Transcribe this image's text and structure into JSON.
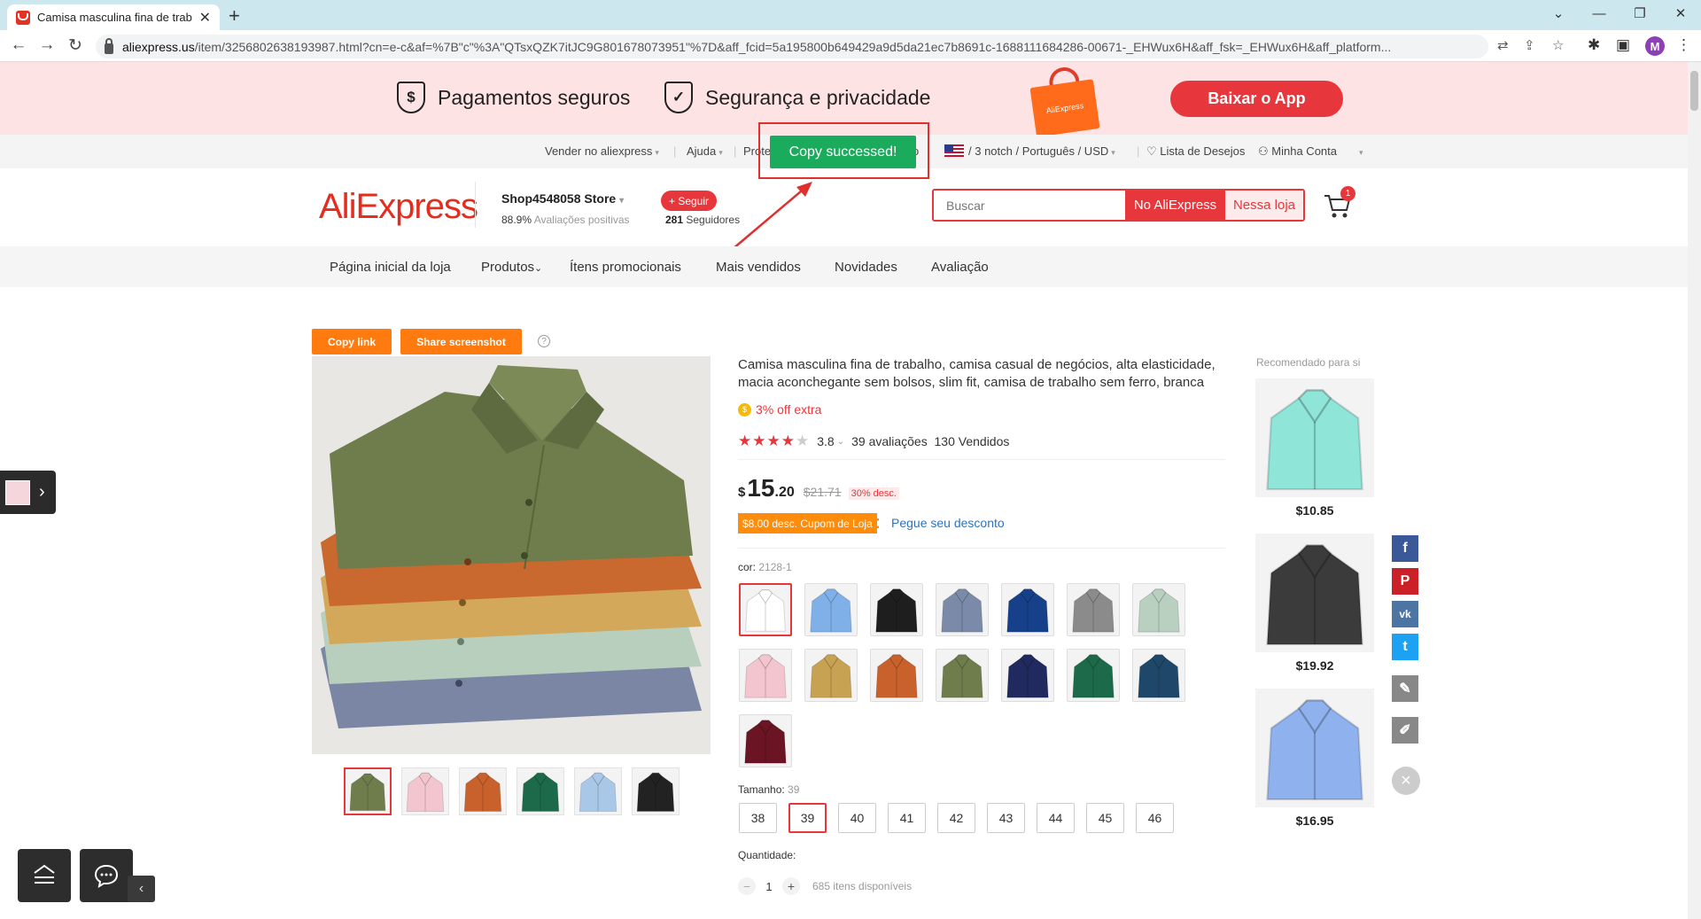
{
  "browser": {
    "tab_title": "Camisa masculina fina de trab",
    "url_host": "aliexpress.us",
    "url_rest": "/item/3256802638193987.html?cn=e-c&af=%7B\"c\"%3A\"QTsxQZK7itJC9G801678073951\"%7D&aff_fcid=5a195800b649429a9d5da21ec7b8691c-1688111684286-00671-_EHWux6H&aff_fsk=_EHWux6H&aff_platform...",
    "profile_initial": "M",
    "minimize": "⌄",
    "accent": "#cde7ee"
  },
  "promo": {
    "secure_payments": "Pagamentos seguros",
    "security_privacy": "Segurança e privacidade",
    "bag_text": "AliExpress",
    "app_button": "Baixar o App"
  },
  "topnav": {
    "sell": "Vender no aliexpress",
    "help": "Ajuda",
    "protection": "Prote",
    "protection_tail": "o",
    "region": "/ 3 notch / Português / USD",
    "wishlist": "Lista de Desejos",
    "account": "Minha Conta"
  },
  "toast": {
    "text": "Copy successed!",
    "color": "#1aab5d"
  },
  "store": {
    "logo": "AliExpress",
    "name": "Shop4548058 Store",
    "rating_pct": "88.9%",
    "rating_label": "Avaliações positivas",
    "follow": "+ Seguir",
    "followers_count": "281",
    "followers_label": "Seguidores",
    "search_placeholder": "Buscar",
    "search_ali": "No AliExpress",
    "search_store": "Nessa loja",
    "cart_count": "1"
  },
  "storenav": [
    "Página inicial da loja",
    "Produtos",
    "Ítens promocionais",
    "Mais vendidos",
    "Novidades",
    "Avaliação"
  ],
  "actions": {
    "copy_link": "Copy link",
    "share_screenshot": "Share screenshot",
    "help": "?"
  },
  "product": {
    "title": "Camisa masculina fina de trabalho, camisa casual de negócios, alta elasticidade, macia aconchegante sem bolsos, slim fit, camisa de trabalho sem ferro, branca",
    "extra": "3% off extra",
    "rating": "3.8",
    "rating_stars": 3.8,
    "reviews": "39 avaliações",
    "sold": "130 Vendidos",
    "currency": "$",
    "price_int": "15",
    "price_dec": ".20",
    "price_old": "$21.71",
    "discount": "30% desc.",
    "coupon": "$8.00 desc. Cupom de Loja",
    "coupon_link": "Pegue seu desconto",
    "color_label": "cor:",
    "color_value": "2128-1",
    "colors": [
      "#ffffff",
      "#7fb0e8",
      "#1e1e1e",
      "#7b8aa8",
      "#17408a",
      "#8b8b8b",
      "#b9cfc0",
      "#f3c6cf",
      "#c7a253",
      "#c8612c",
      "#6f7d4d",
      "#202a5e",
      "#1d6a4a",
      "#1f4769",
      "#6b1424"
    ],
    "size_label": "Tamanho:",
    "size_value": "39",
    "sizes": [
      "38",
      "39",
      "40",
      "41",
      "42",
      "43",
      "44",
      "45",
      "46"
    ],
    "qty_label": "Quantidade:",
    "qty_minus": "−",
    "qty_value": "1",
    "qty_plus": "+",
    "available": "685 itens disponíveis",
    "thumb_colors": [
      "#6f7d4d",
      "#f3c6cf",
      "#c8612c",
      "#1d6a4a",
      "#a9c7e6",
      "#222222"
    ]
  },
  "recommended": {
    "title": "Recomendado para si",
    "items": [
      {
        "price": "$10.85",
        "color": "#8fe5d8"
      },
      {
        "price": "$19.92",
        "color": "#3b3b3b"
      },
      {
        "price": "$16.95",
        "color": "#8fb2ef"
      }
    ]
  },
  "social": {
    "facebook": "f",
    "pinterest": "P",
    "vk": "vk",
    "twitter": "t",
    "close": "×"
  }
}
